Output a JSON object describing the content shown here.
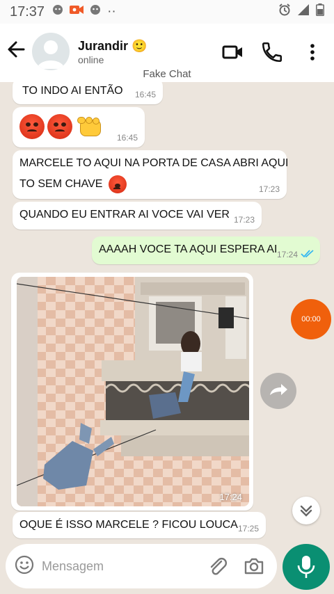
{
  "status_bar": {
    "time": "17:37",
    "more": "··"
  },
  "header": {
    "contact_name": "Jurandir 🙂",
    "contact_status": "online",
    "watermark": "Fake Chat"
  },
  "messages": [
    {
      "direction": "in",
      "text": "TO INDO AI ENTÃO",
      "time": "16:45"
    },
    {
      "direction": "in",
      "emojis": [
        "angry-face",
        "angry-face",
        "oncoming-fist"
      ],
      "time": "16:45"
    },
    {
      "direction": "in",
      "text_line1": "MARCELE TO AQUI NA PORTA DE CASA ABRI AQUI",
      "text_line2": "TO SEM CHAVE",
      "emoji": "angry-face",
      "time": "17:23"
    },
    {
      "direction": "in",
      "text": "QUANDO EU ENTRAR AI VOCE VAI VER",
      "time": "17:23"
    },
    {
      "direction": "out",
      "text": "AAAAH VOCE TA AQUI ESPERA AI",
      "time": "17:24",
      "status": "read"
    },
    {
      "direction": "in",
      "type": "image",
      "time": "17:24"
    },
    {
      "direction": "in",
      "text": "OQUE É ISSO MARCELE ? FICOU LOUCA",
      "time": "17:25"
    }
  ],
  "recorder": {
    "label": "00:00"
  },
  "composer": {
    "placeholder": "Mensagem"
  },
  "colors": {
    "chat_background": "#ece5dd",
    "outgoing_bubble": "#e2fbd2",
    "accent": "#0a8f72",
    "record": "#f0600c",
    "read_ticks": "#34b7f1"
  }
}
